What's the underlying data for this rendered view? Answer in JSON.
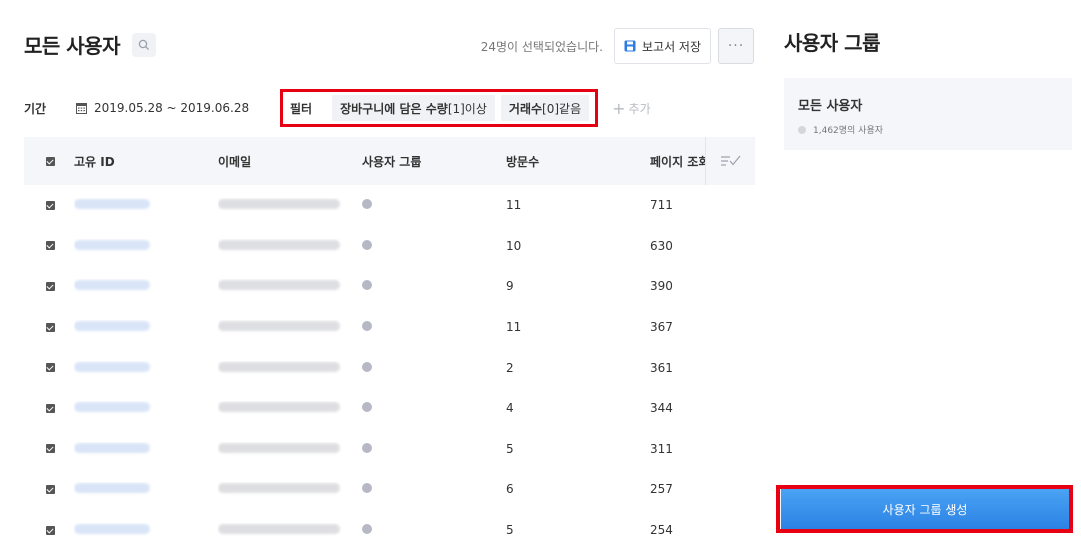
{
  "header": {
    "title": "모든 사용자",
    "selected_text": "24명이 선택되었습니다.",
    "report_button": "보고서 저장",
    "more_button": "···"
  },
  "filters": {
    "period_label": "기간",
    "date_range": "2019.05.28 ~ 2019.06.28",
    "filter_label": "필터",
    "chip1_name": "장바구니에 담은 수량",
    "chip1_value": "[1]이상",
    "chip2_name": "거래수",
    "chip2_value": "[0]같음",
    "add_label": "추가"
  },
  "table": {
    "columns": {
      "id": "고유 ID",
      "email": "이메일",
      "group": "사용자 그룹",
      "visits": "방문수",
      "views": "페이지 조회"
    },
    "rows": [
      {
        "visits": "11",
        "views": "711"
      },
      {
        "visits": "10",
        "views": "630"
      },
      {
        "visits": "9",
        "views": "390"
      },
      {
        "visits": "11",
        "views": "367"
      },
      {
        "visits": "2",
        "views": "361"
      },
      {
        "visits": "4",
        "views": "344"
      },
      {
        "visits": "5",
        "views": "311"
      },
      {
        "visits": "6",
        "views": "257"
      },
      {
        "visits": "5",
        "views": "254"
      }
    ]
  },
  "sidebar": {
    "title": "사용자 그룹",
    "group_name": "모든 사용자",
    "group_count": "1,462명의 사용자",
    "create_button": "사용자 그룹 생성"
  },
  "colors": {
    "accent_red": "#e60012",
    "button_blue": "#2c82e4",
    "panel_bg": "#f5f6f9",
    "group_dot": "#b6b8c6"
  },
  "icons": [
    "search-icon",
    "save-icon",
    "calendar-icon",
    "plus-icon",
    "column-settings-icon",
    "checkbox-icon"
  ]
}
